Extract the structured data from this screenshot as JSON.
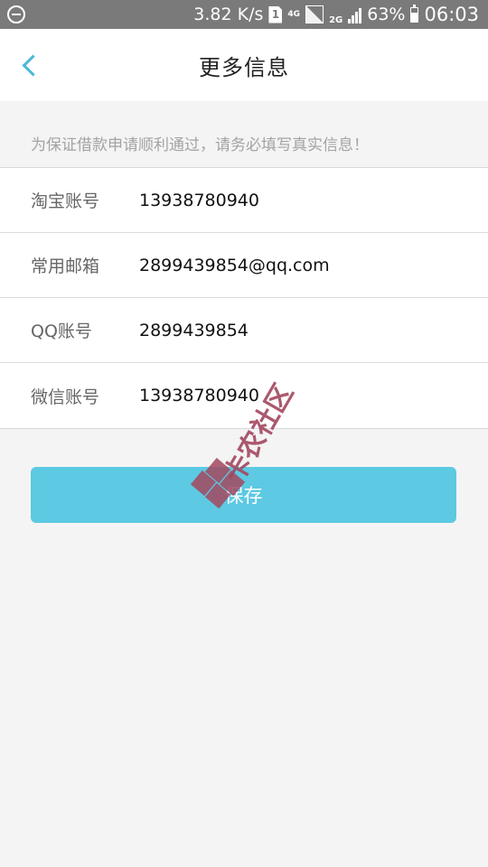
{
  "status_bar": {
    "speed": "3.82 K/s",
    "sim_slot": "1",
    "network_type": "4G",
    "network_type_2": "2G",
    "battery_percent": "63%",
    "battery_level": 0.63,
    "time": "06:03"
  },
  "nav": {
    "title": "更多信息"
  },
  "notice": "为保证借款申请顺利通过，请务必填写真实信息！",
  "fields": [
    {
      "label": "淘宝账号",
      "value": "13938780940"
    },
    {
      "label": "常用邮箱",
      "value": "2899439854@qq.com"
    },
    {
      "label": "QQ账号",
      "value": "2899439854"
    },
    {
      "label": "微信账号",
      "value": "13938780940"
    }
  ],
  "save_button": {
    "label": "保存"
  },
  "watermark": {
    "text": "卡农社区"
  },
  "colors": {
    "accent": "#5dc9e2",
    "back_arrow": "#49b8d7",
    "status_bar": "#7a7a7a",
    "background": "#f4f4f4"
  }
}
